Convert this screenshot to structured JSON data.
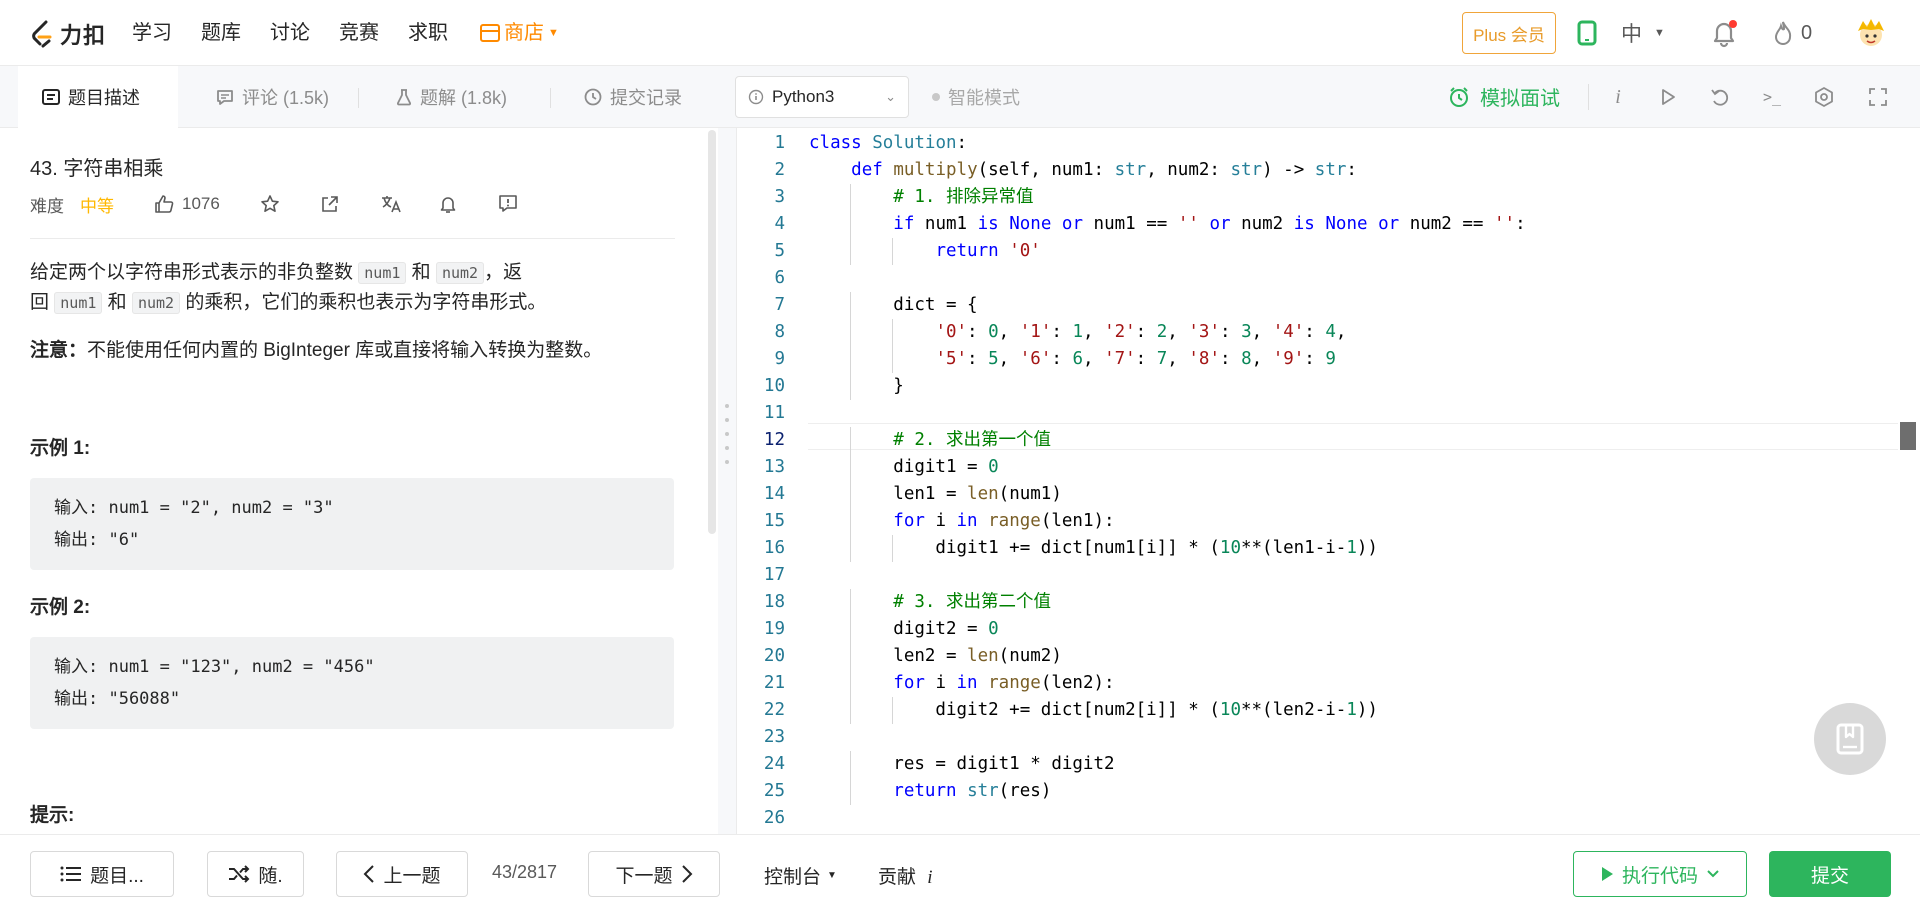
{
  "nav": {
    "logo_text": "力扣",
    "items": [
      "学习",
      "题库",
      "讨论",
      "竞赛",
      "求职"
    ],
    "store": "商店",
    "plus": "Plus 会员",
    "lang": "中",
    "fire_count": "0"
  },
  "tabs": {
    "desc": "题目描述",
    "comments": "评论 (1.5k)",
    "solutions": "题解 (1.8k)",
    "submissions": "提交记录"
  },
  "toolbar": {
    "language": "Python3",
    "smart_mode": "智能模式",
    "interview": "模拟面试",
    "info_icon_text": "i",
    "console_icon_text": ">_"
  },
  "problem": {
    "title": "43. 字符串相乘",
    "difficulty_label": "难度",
    "difficulty": "中等",
    "likes": "1076",
    "desc_part1": "给定两个以字符串形式表示的非负整数 ",
    "code_num1": "num1",
    "desc_and": " 和 ",
    "code_num2": "num2",
    "desc_part2": "，返",
    "desc_part3": "回 ",
    "desc_part4": " 的乘积，它们的乘积也表示为字符串形式。",
    "note_label": "注意：",
    "note_text": "不能使用任何内置的 BigInteger 库或直接将输入转换为整数。",
    "example1_title": "示例 1:",
    "example1_in": "输入: num1 = \"2\", num2 = \"3\"",
    "example1_out": "输出: \"6\"",
    "example2_title": "示例 2:",
    "example2_in": "输入: num1 = \"123\", num2 = \"456\"",
    "example2_out": "输出: \"56088\"",
    "hint_title": "提示:"
  },
  "code_lines": [
    "class Solution:",
    "    def multiply(self, num1: str, num2: str) -> str:",
    "        # 1. 排除异常值",
    "        if num1 is None or num1 == '' or num2 is None or num2 == '':",
    "            return '0'",
    "",
    "        dict = {",
    "            '0': 0, '1': 1, '2': 2, '3': 3, '4': 4,",
    "            '5': 5, '6': 6, '7': 7, '8': 8, '9': 9",
    "        }",
    "",
    "        # 2. 求出第一个值",
    "        digit1 = 0",
    "        len1 = len(num1)",
    "        for i in range(len1):",
    "            digit1 += dict[num1[i]] * (10**(len1-i-1))",
    "",
    "        # 3. 求出第二个值",
    "        digit2 = 0",
    "        len2 = len(num2)",
    "        for i in range(len2):",
    "            digit2 += dict[num2[i]] * (10**(len2-i-1))",
    "",
    "        res = digit1 * digit2",
    "        return str(res)",
    ""
  ],
  "current_line": 12,
  "bottom": {
    "problem_list": "题目...",
    "random": "随.",
    "prev": "上一题",
    "pager": "43/2817",
    "next": "下一题",
    "console": "控制台",
    "contribute": "贡献",
    "contribute_icon_text": "i",
    "run": "执行代码",
    "submit": "提交"
  },
  "colors": {
    "accent_green": "#2db55d",
    "difficulty_medium": "#ffb800",
    "store_orange": "#ff8a00"
  }
}
